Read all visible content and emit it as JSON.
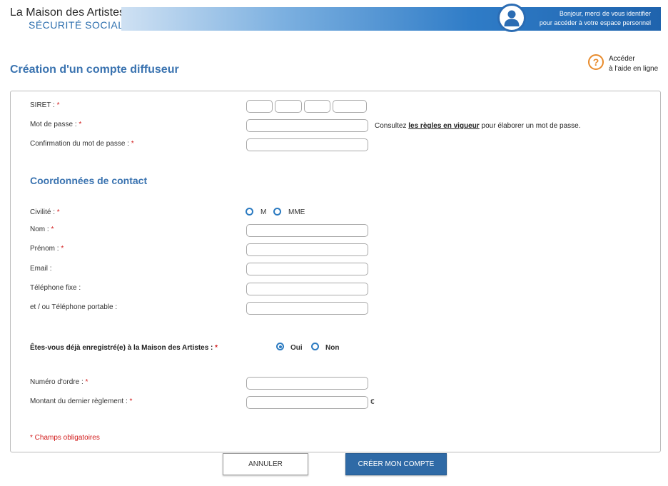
{
  "header": {
    "logo_line1": "La Maison des Artistes",
    "logo_line2": "SÉCURITÉ SOCIALE",
    "greeting_line1": "Bonjour, merci de vous identifier",
    "greeting_line2": "pour accéder à votre espace personnel",
    "avatar_icon": "user-icon"
  },
  "page": {
    "title": "Création d'un compte diffuseur",
    "help_icon": "help-icon",
    "help_line1": "Accéder",
    "help_line2": "à l'aide en ligne"
  },
  "form": {
    "required_mark": "*",
    "siret_label": "SIRET :",
    "password_label": "Mot de passe :",
    "password_hint_before": "Consultez ",
    "password_hint_link": "les règles en vigueur",
    "password_hint_after": " pour élaborer un mot de passe.",
    "password_confirm_label": "Confirmation du mot de passe :",
    "contact_section_title": "Coordonnées de contact",
    "civility_label": "Civilité :",
    "civility_options": [
      "M",
      "MME"
    ],
    "lastname_label": "Nom :",
    "firstname_label": "Prénom :",
    "email_label": "Email :",
    "phone_label": "Téléphone fixe :",
    "mobile_label": "et / ou Téléphone portable :",
    "registered_question": "Êtes-vous déjà enregistré(e) à la Maison des Artistes :",
    "registered_options": [
      "Oui",
      "Non"
    ],
    "registered_selected": "Oui",
    "order_number_label": "Numéro d'ordre :",
    "last_payment_label": "Montant du dernier règlement :",
    "currency": "€",
    "required_note": "* Champs obligatoires"
  },
  "buttons": {
    "cancel": "ANNULER",
    "create": "CRÉER MON COMPTE"
  },
  "colors": {
    "accent": "#3a73b0",
    "required": "#d21c1c",
    "help": "#e88a2a",
    "primary_button": "#2f6aa6"
  }
}
